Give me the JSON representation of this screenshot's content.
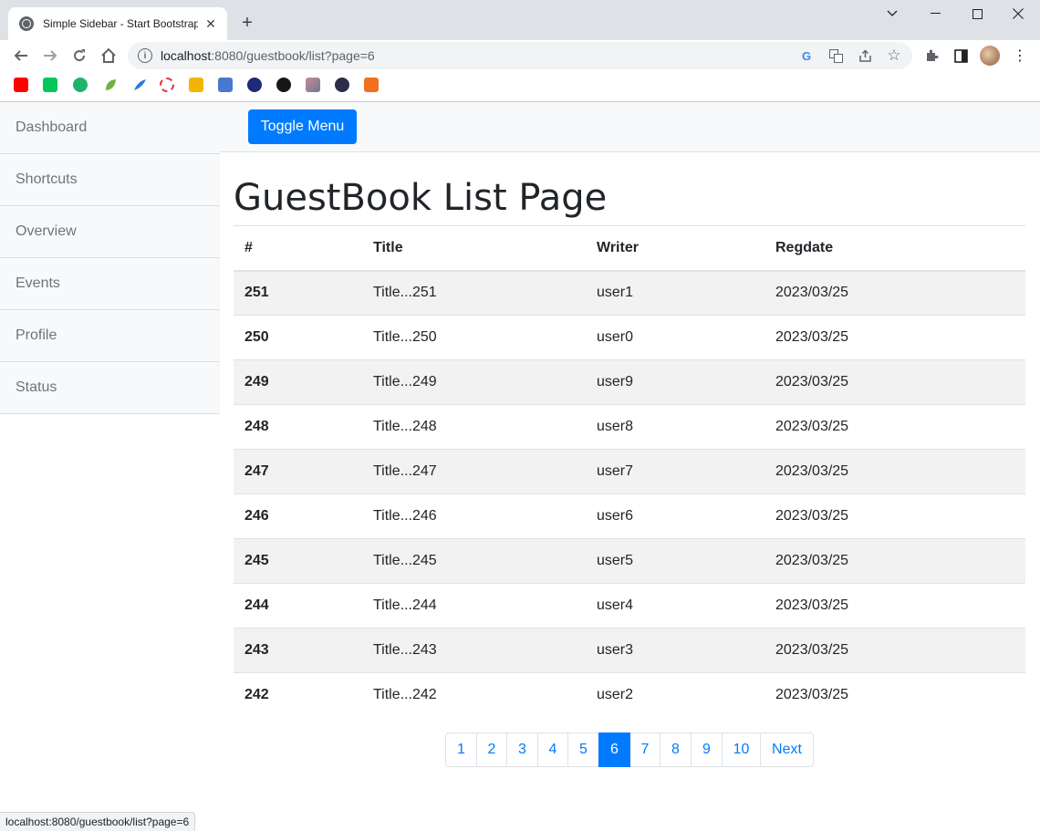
{
  "browser": {
    "tab_title": "Simple Sidebar - Start Bootstrap",
    "url_host": "localhost",
    "url_rest": ":8080/guestbook/list?page=6",
    "status_url": "localhost:8080/guestbook/list?page=6"
  },
  "sidebar": {
    "items": [
      {
        "label": "Dashboard"
      },
      {
        "label": "Shortcuts"
      },
      {
        "label": "Overview"
      },
      {
        "label": "Events"
      },
      {
        "label": "Profile"
      },
      {
        "label": "Status"
      }
    ]
  },
  "topnav": {
    "toggle_label": "Toggle Menu"
  },
  "main": {
    "title": "GuestBook List Page",
    "columns": [
      "#",
      "Title",
      "Writer",
      "Regdate"
    ],
    "rows": [
      {
        "num": "251",
        "title": "Title...251",
        "writer": "user1",
        "regdate": "2023/03/25"
      },
      {
        "num": "250",
        "title": "Title...250",
        "writer": "user0",
        "regdate": "2023/03/25"
      },
      {
        "num": "249",
        "title": "Title...249",
        "writer": "user9",
        "regdate": "2023/03/25"
      },
      {
        "num": "248",
        "title": "Title...248",
        "writer": "user8",
        "regdate": "2023/03/25"
      },
      {
        "num": "247",
        "title": "Title...247",
        "writer": "user7",
        "regdate": "2023/03/25"
      },
      {
        "num": "246",
        "title": "Title...246",
        "writer": "user6",
        "regdate": "2023/03/25"
      },
      {
        "num": "245",
        "title": "Title...245",
        "writer": "user5",
        "regdate": "2023/03/25"
      },
      {
        "num": "244",
        "title": "Title...244",
        "writer": "user4",
        "regdate": "2023/03/25"
      },
      {
        "num": "243",
        "title": "Title...243",
        "writer": "user3",
        "regdate": "2023/03/25"
      },
      {
        "num": "242",
        "title": "Title...242",
        "writer": "user2",
        "regdate": "2023/03/25"
      }
    ]
  },
  "pagination": {
    "pages": [
      "1",
      "2",
      "3",
      "4",
      "5",
      "6",
      "7",
      "8",
      "9",
      "10"
    ],
    "active": "6",
    "next_label": "Next"
  },
  "colors": {
    "primary": "#007bff",
    "sidebar_bg": "#f8f9fa",
    "stripe": "#f2f2f2"
  }
}
